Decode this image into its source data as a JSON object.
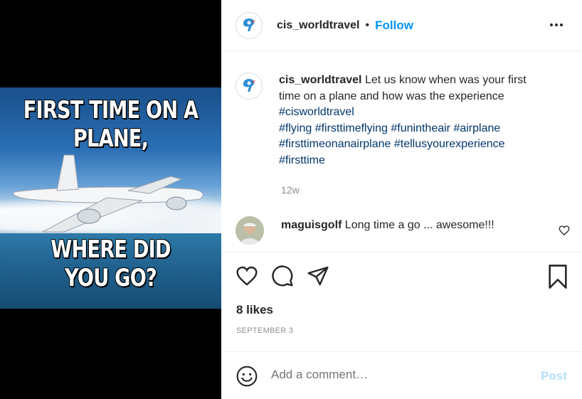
{
  "media": {
    "text_top_line1": "FIRST TIME ON A",
    "text_top_line2": "PLANE,",
    "text_bottom_line1": "WHERE DID",
    "text_bottom_line2": "YOU GO?"
  },
  "header": {
    "username": "cis_worldtravel",
    "separator": "•",
    "follow_label": "Follow",
    "more_icon": "more-horizontal-icon"
  },
  "caption": {
    "username": "cis_worldtravel",
    "text": "Let us know when was your first time on a plane and how was the experience",
    "hashtags": "#cisworldtravel\n#flying #firsttimeflying #funintheair #airplane #firsttimeonanairplane #tellusyourexperience #firsttime",
    "time": "12w"
  },
  "comment": {
    "username": "maguisgolf",
    "text": "Long time a go ... awesome!!!"
  },
  "actions": {
    "like_icon": "heart-icon",
    "comment_icon": "comment-bubble-icon",
    "share_icon": "paper-plane-icon",
    "save_icon": "bookmark-icon"
  },
  "likes": "8 likes",
  "date": "SEPTEMBER 3",
  "add_comment": {
    "placeholder": "Add a comment…",
    "post_label": "Post"
  },
  "colors": {
    "accent": "#0095f6",
    "hashtag": "#00376b",
    "muted": "#8e8e8e",
    "post_disabled": "#b2dffc"
  }
}
